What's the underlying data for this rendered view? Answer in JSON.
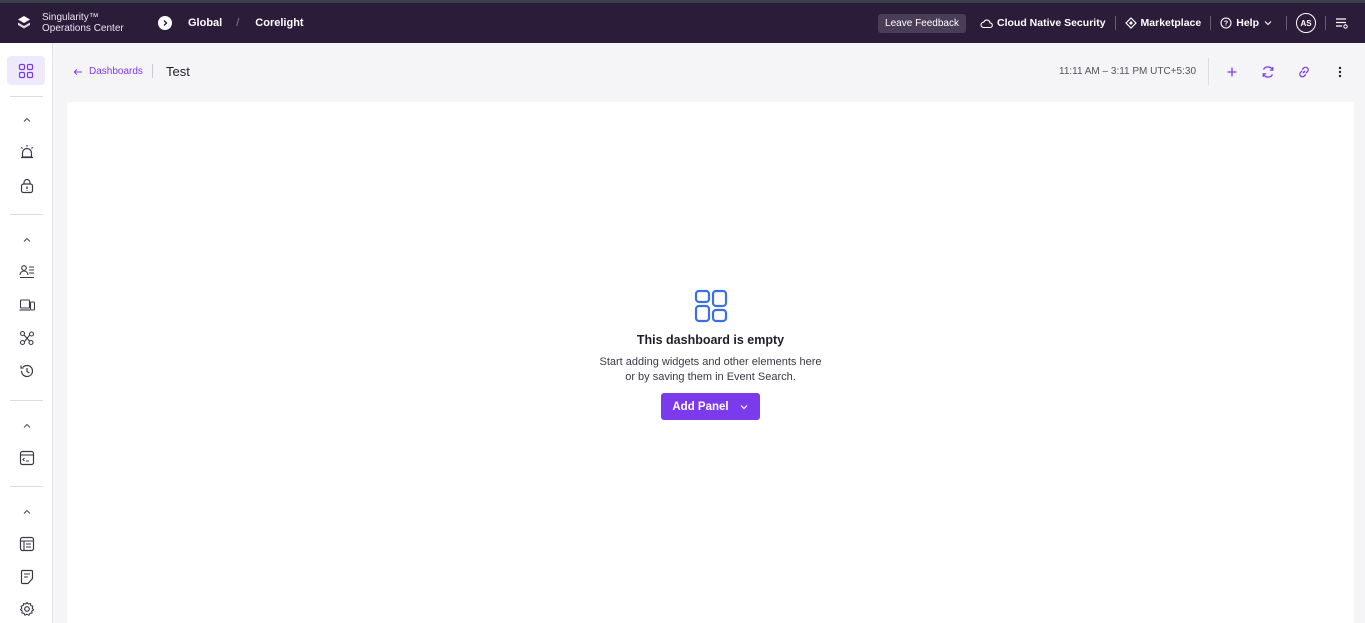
{
  "topbar": {
    "brand_line1": "Singularity™",
    "brand_line2": "Operations Center",
    "scope_primary": "Global",
    "scope_separator": "/",
    "scope_secondary": "Corelight",
    "feedback": "Leave Feedback",
    "cloud_native": "Cloud Native Security",
    "marketplace": "Marketplace",
    "help": "Help",
    "avatar_initials": "AS"
  },
  "header": {
    "back_label": "Dashboards",
    "title": "Test",
    "time_range": "11:11 AM – 3:11 PM UTC+5:30"
  },
  "empty_state": {
    "title": "This dashboard is empty",
    "desc_line1": "Start adding widgets and other elements here",
    "desc_line2": "or by saving them in Event Search.",
    "button": "Add Panel"
  },
  "colors": {
    "accent": "#7c3aed",
    "topbar_bg": "#2b1c3a",
    "empty_icon": "#3b6fe6"
  },
  "icons": {
    "rail": [
      "dashboards-icon",
      "chevron-up-icon",
      "alert-siren-icon",
      "threat-lock-icon",
      "chevron-up-icon",
      "identity-list-icon",
      "devices-icon",
      "graph-icon",
      "history-icon",
      "chevron-up-icon",
      "console-icon",
      "chevron-up-icon",
      "table-icon",
      "notes-icon",
      "settings-icon"
    ],
    "header": [
      "plus-icon",
      "refresh-icon",
      "link-icon",
      "more-vertical-icon"
    ]
  }
}
